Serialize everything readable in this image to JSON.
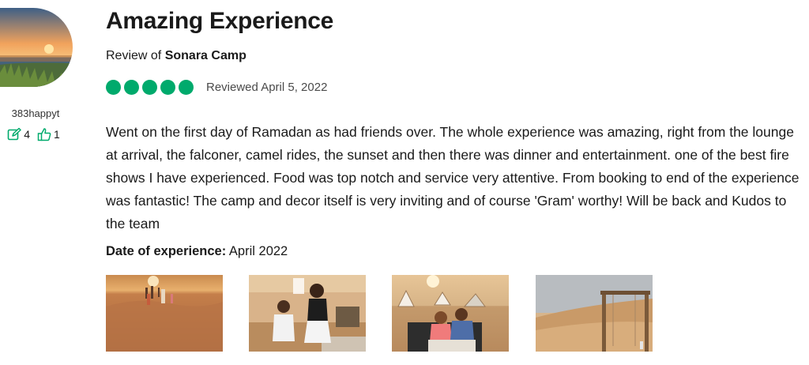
{
  "reviewer": {
    "username": "383happyt",
    "contributions_count": "4",
    "helpful_votes": "1",
    "avatar_icon": "sunset-avatar",
    "contributions_icon": "edit-icon",
    "helpful_icon": "thumbs-up-icon"
  },
  "review": {
    "title": "Amazing Experience",
    "subtitle_prefix": "Review of ",
    "place": "Sonara Camp",
    "rating": 5,
    "rating_max": 5,
    "rating_color": "#00aa6c",
    "reviewed_date": "Reviewed April 5, 2022",
    "body": "Went on the first day of Ramadan as had friends over. The whole experience was amazing, right from the lounge at arrival, the falconer, camel rides, the sunset and then there was dinner and entertainment. one of the best fire shows I have experienced. Food was top notch and service very attentive. From booking to end of the experience was fantastic! The camp and decor itself is very inviting and of course 'Gram' worthy! Will be back and Kudos to the team",
    "date_of_experience_label": "Date of experience:",
    "date_of_experience_value": "April 2022"
  },
  "photos": [
    {
      "name": "desert-sunset-photo"
    },
    {
      "name": "children-dancing-photo"
    },
    {
      "name": "couple-seated-photo"
    },
    {
      "name": "wooden-swing-photo"
    }
  ]
}
